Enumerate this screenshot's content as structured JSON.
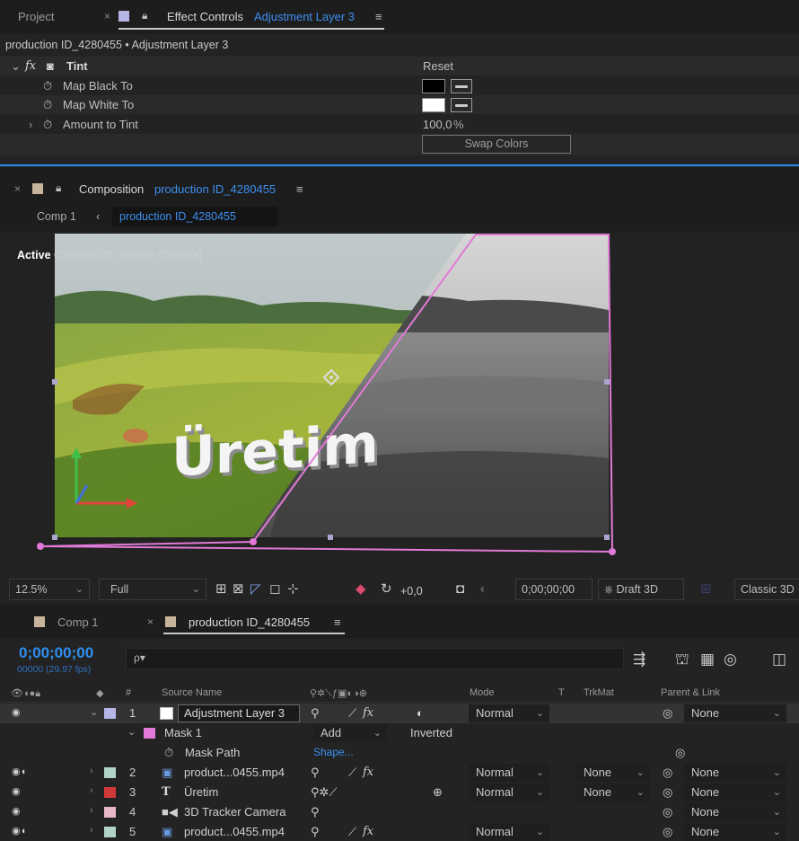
{
  "effect_controls": {
    "tab_project": "Project",
    "tab_effect_controls": "Effect Controls",
    "tab_layer": "Adjustment Layer 3",
    "menu_glyph": "≡",
    "close_glyph": "×",
    "breadcrumb": "production ID_4280455 • Adjustment Layer 3",
    "effect_name": "Tint",
    "fx_glyph": "fx",
    "reset": "Reset",
    "props": [
      {
        "label": "Map Black To",
        "color": "#000000"
      },
      {
        "label": "Map White To",
        "color": "#ffffff"
      },
      {
        "label": "Amount to Tint",
        "value": "100,0",
        "unit": "%"
      }
    ],
    "swap_colors": "Swap Colors"
  },
  "composition": {
    "tab_label": "Composition",
    "comp_name": "production ID_4280455",
    "breadcrumb_comp1": "Comp 1",
    "breadcrumb_active": "production ID_4280455",
    "active_camera_bold": "Active",
    "active_camera_rest": " Camera (3D Tracker Camera)",
    "text_layer": "Üretim",
    "toolbar": {
      "zoom": "12.5%",
      "resolution": "Full",
      "exposure": "+0,0",
      "timecode": "0;00;00;00",
      "draft3d": "Draft 3D",
      "renderer": "Classic 3D"
    }
  },
  "timeline": {
    "tab_comp1": "Comp 1",
    "tab_production": "production ID_4280455",
    "timecode": "0;00;00;00",
    "frames": "00000 (29.97 fps)",
    "search_glyph": "ρ▾",
    "columns": {
      "hash": "#",
      "source_name": "Source Name",
      "mode": "Mode",
      "t": "T",
      "trkmat": "TrkMat",
      "parent": "Parent & Link"
    },
    "layers": [
      {
        "num": "1",
        "name": "Adjustment Layer 3",
        "color": "#b6b6e6",
        "mode": "Normal",
        "trkmat": "",
        "parent": "None"
      },
      {
        "num": "2",
        "name": "product...0455.mp4",
        "color": "#b0d4c8",
        "mode": "Normal",
        "trkmat": "None",
        "parent": "None"
      },
      {
        "num": "3",
        "name": "Üretim",
        "color": "#d23838",
        "mode": "Normal",
        "trkmat": "None",
        "parent": "None"
      },
      {
        "num": "4",
        "name": "3D Tracker Camera",
        "color": "#e8b8c8",
        "mode": "",
        "trkmat": "",
        "parent": "None"
      },
      {
        "num": "5",
        "name": "product...0455.mp4",
        "color": "#b0d4c8",
        "mode": "Normal",
        "trkmat": "",
        "parent": "None"
      }
    ],
    "mask": {
      "name": "Mask 1",
      "mode": "Add",
      "inverted": "Inverted",
      "path_label": "Mask Path",
      "path_value": "Shape..."
    }
  },
  "colors": {
    "accent_blue": "#2f8ef0",
    "mask_pink": "#e07ad6",
    "adjustment_label": "#b6b6e6"
  }
}
